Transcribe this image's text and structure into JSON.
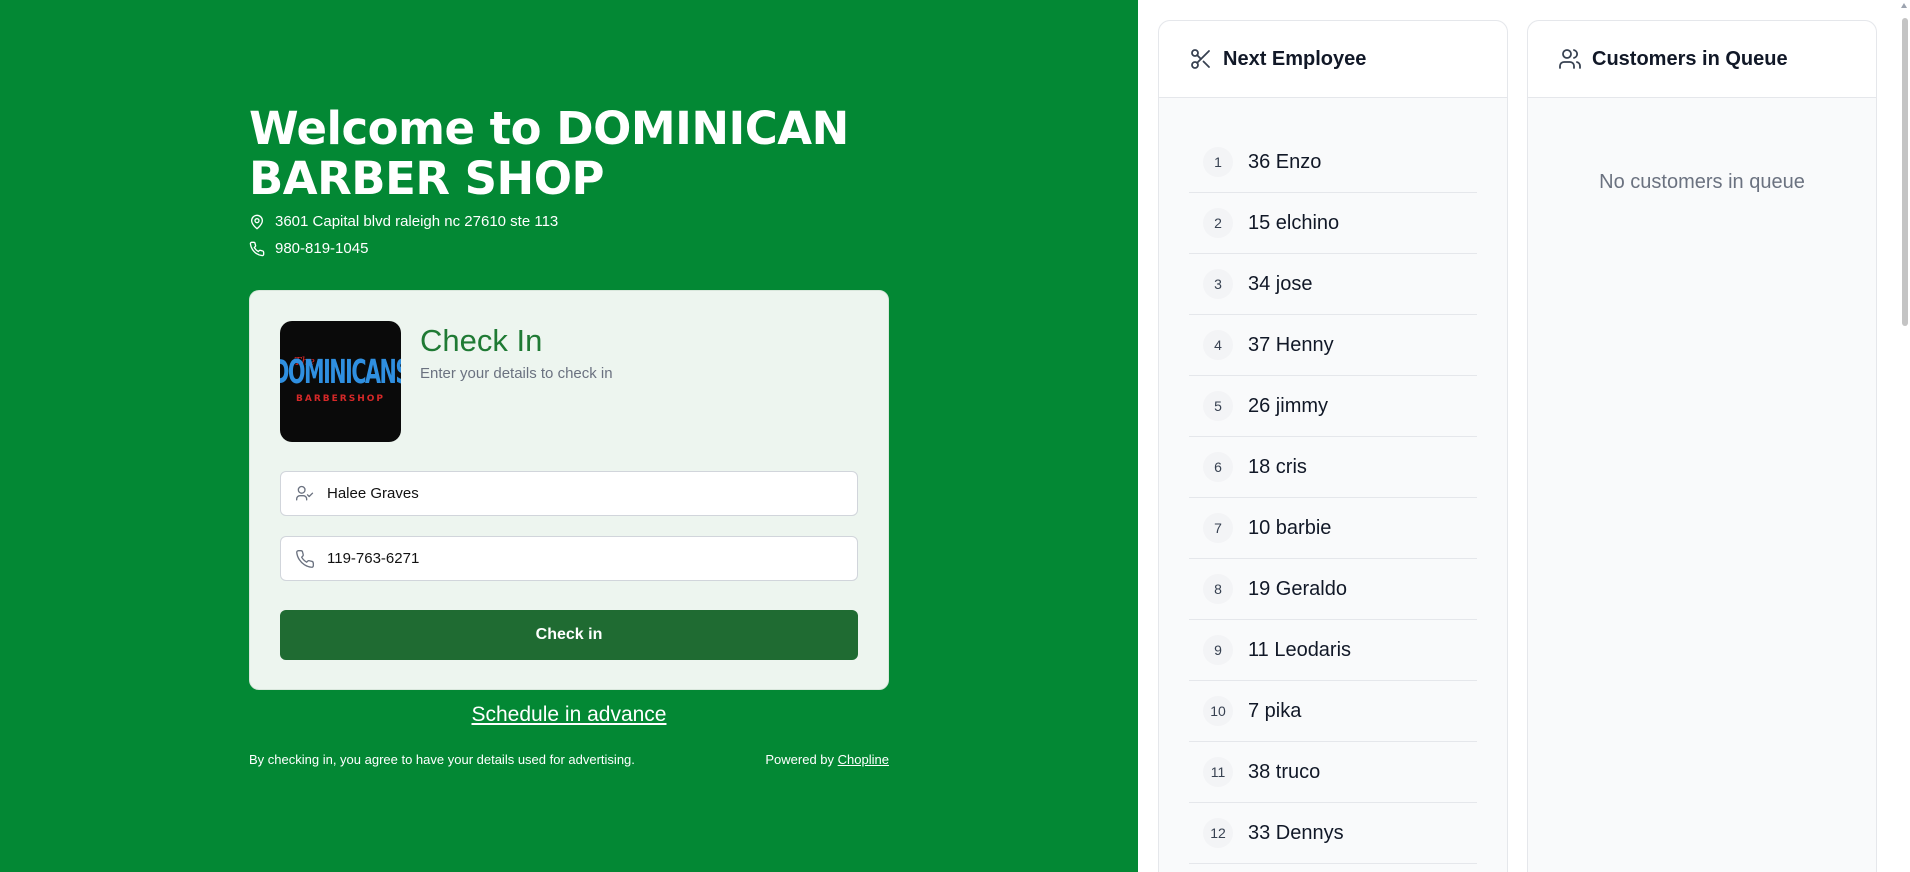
{
  "header": {
    "title": "Welcome to DOMINICAN BARBER SHOP",
    "address": "3601 Capital blvd raleigh nc 27610 ste 113",
    "phone": "980-819-1045"
  },
  "checkin": {
    "logo": {
      "the": "The",
      "name": "DOMINICANS",
      "tagline": "BARBERSHOP"
    },
    "title": "Check In",
    "subtitle": "Enter your details to check in",
    "name_value": "Halee Graves",
    "phone_value": "119-763-6271",
    "button_label": "Check in"
  },
  "schedule_link": "Schedule in advance",
  "footer": {
    "disclaimer": "By checking in, you agree to have your details used for advertising.",
    "powered_prefix": "Powered by",
    "powered_link": "Chopline"
  },
  "next_employee": {
    "title": "Next Employee",
    "items": [
      {
        "pos": "1",
        "name": "36 Enzo"
      },
      {
        "pos": "2",
        "name": "15 elchino"
      },
      {
        "pos": "3",
        "name": "34 jose"
      },
      {
        "pos": "4",
        "name": "37 Henny"
      },
      {
        "pos": "5",
        "name": "26 jimmy"
      },
      {
        "pos": "6",
        "name": "18 cris"
      },
      {
        "pos": "7",
        "name": "10 barbie"
      },
      {
        "pos": "8",
        "name": "19 Geraldo"
      },
      {
        "pos": "9",
        "name": "11 Leodaris"
      },
      {
        "pos": "10",
        "name": "7 pika"
      },
      {
        "pos": "11",
        "name": "38 truco"
      },
      {
        "pos": "12",
        "name": "33 Dennys"
      }
    ]
  },
  "queue": {
    "title": "Customers in Queue",
    "empty_text": "No customers in queue"
  },
  "colors": {
    "brand_green": "#038834",
    "button_green": "#1f6b32",
    "title_green": "#1f7a34"
  }
}
